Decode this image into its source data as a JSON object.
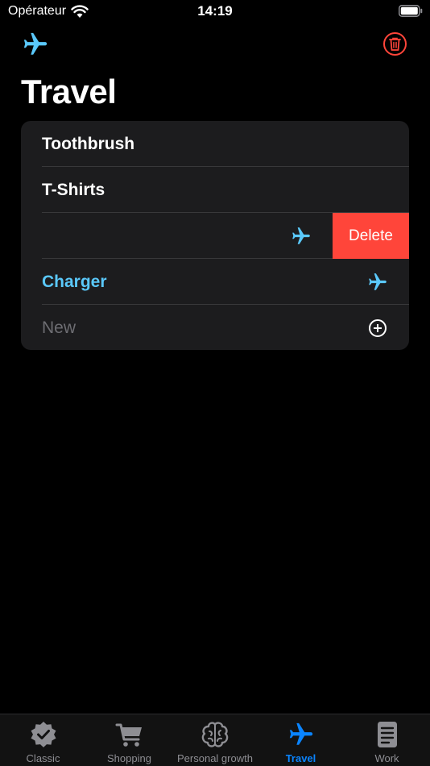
{
  "status_bar": {
    "carrier": "Opérateur",
    "time": "14:19"
  },
  "header": {
    "title": "Travel"
  },
  "list": {
    "items": [
      {
        "label": "Toothbrush"
      },
      {
        "label": "T-Shirts"
      },
      {
        "label": ""
      },
      {
        "label": "Charger"
      }
    ],
    "delete_label": "Delete",
    "new_placeholder": "New"
  },
  "tabs": [
    {
      "label": "Classic",
      "icon": "checkmark-seal-icon"
    },
    {
      "label": "Shopping",
      "icon": "cart-icon"
    },
    {
      "label": "Personal growth",
      "icon": "brain-icon"
    },
    {
      "label": "Travel",
      "icon": "airplane-icon",
      "active": true
    },
    {
      "label": "Work",
      "icon": "notebook-icon"
    }
  ],
  "colors": {
    "accent": "#5ac8fa",
    "tab_active": "#0a84ff",
    "destructive": "#ff453a",
    "cell": "#1c1c1e"
  }
}
